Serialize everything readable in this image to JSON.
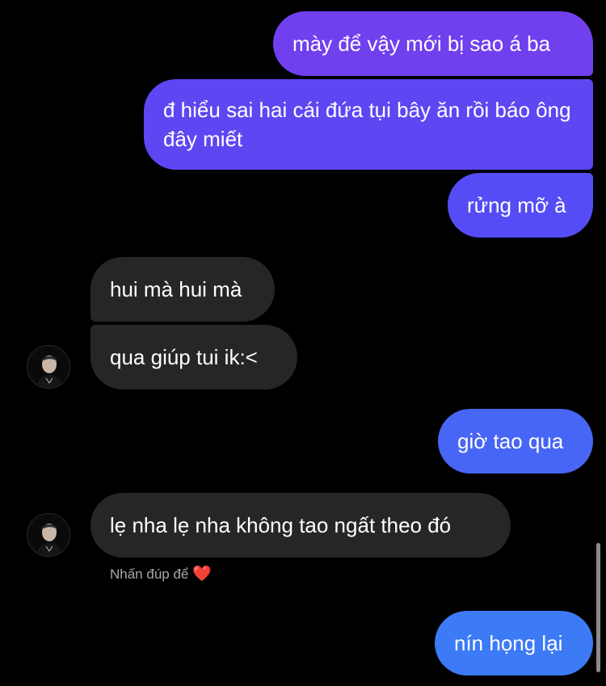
{
  "colors": {
    "background": "#000000",
    "outgoing_top": "#6c40f0",
    "outgoing_mid": "#5b47f5",
    "outgoing_bottom": "#3e78f5",
    "incoming": "#262626",
    "hint_text": "#a8a8a8",
    "heart": "#ed2e45"
  },
  "messages": [
    {
      "direction": "outgoing",
      "text": "mày để vậy mới bị sao á ba"
    },
    {
      "direction": "outgoing",
      "text": "đ hiểu sai hai cái đứa tụi bây ăn rồi báo ông đây miết"
    },
    {
      "direction": "outgoing",
      "text": "rửng mỡ à"
    },
    {
      "direction": "incoming",
      "text": "hui mà hui mà"
    },
    {
      "direction": "incoming",
      "text": "qua giúp tui ik:<"
    },
    {
      "direction": "outgoing",
      "text": "giờ tao qua"
    },
    {
      "direction": "incoming",
      "text": "lẹ nha lẹ nha không tao ngất theo đó"
    },
    {
      "direction": "outgoing",
      "text": "nín họng lại"
    }
  ],
  "reaction_hint": {
    "text": "Nhấn đúp để",
    "icon": "heart-icon",
    "glyph": "❤️"
  }
}
